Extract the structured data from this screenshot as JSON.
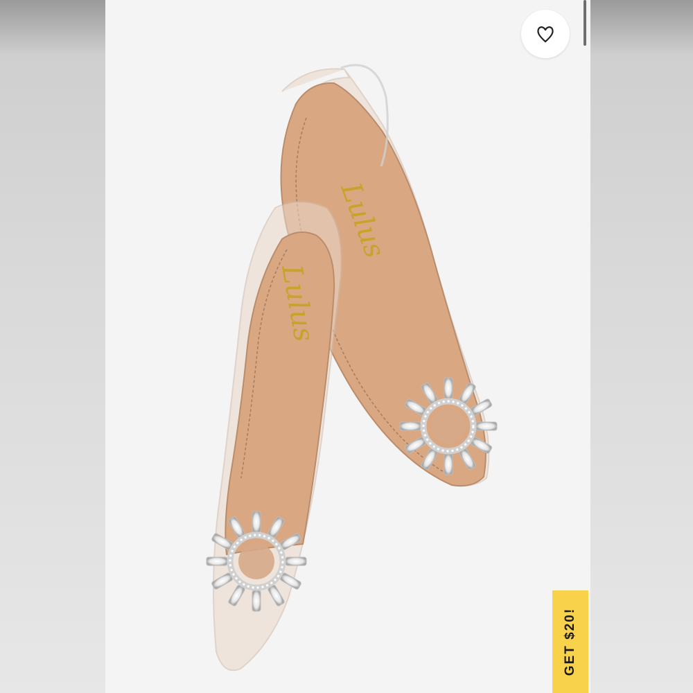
{
  "product_image": {
    "alt": "",
    "brand_imprint": "Lulus"
  },
  "favorite_button": {
    "icon": "heart-outline-icon"
  },
  "promo_tab": {
    "label": "GET $20!",
    "color": "#f7d24a"
  },
  "colors": {
    "background": "#f4f4f4",
    "insole": "#d9a883",
    "clear_vinyl": "#e8d6c8",
    "rhinestone": "#e6e6e6"
  }
}
